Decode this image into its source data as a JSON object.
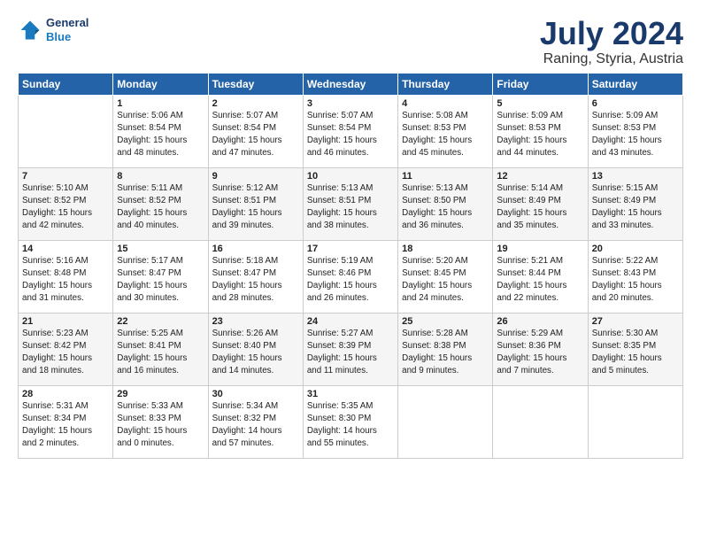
{
  "header": {
    "logo_line1": "General",
    "logo_line2": "Blue",
    "month": "July 2024",
    "location": "Raning, Styria, Austria"
  },
  "weekdays": [
    "Sunday",
    "Monday",
    "Tuesday",
    "Wednesday",
    "Thursday",
    "Friday",
    "Saturday"
  ],
  "weeks": [
    [
      {
        "day": "",
        "info": ""
      },
      {
        "day": "1",
        "info": "Sunrise: 5:06 AM\nSunset: 8:54 PM\nDaylight: 15 hours\nand 48 minutes."
      },
      {
        "day": "2",
        "info": "Sunrise: 5:07 AM\nSunset: 8:54 PM\nDaylight: 15 hours\nand 47 minutes."
      },
      {
        "day": "3",
        "info": "Sunrise: 5:07 AM\nSunset: 8:54 PM\nDaylight: 15 hours\nand 46 minutes."
      },
      {
        "day": "4",
        "info": "Sunrise: 5:08 AM\nSunset: 8:53 PM\nDaylight: 15 hours\nand 45 minutes."
      },
      {
        "day": "5",
        "info": "Sunrise: 5:09 AM\nSunset: 8:53 PM\nDaylight: 15 hours\nand 44 minutes."
      },
      {
        "day": "6",
        "info": "Sunrise: 5:09 AM\nSunset: 8:53 PM\nDaylight: 15 hours\nand 43 minutes."
      }
    ],
    [
      {
        "day": "7",
        "info": "Sunrise: 5:10 AM\nSunset: 8:52 PM\nDaylight: 15 hours\nand 42 minutes."
      },
      {
        "day": "8",
        "info": "Sunrise: 5:11 AM\nSunset: 8:52 PM\nDaylight: 15 hours\nand 40 minutes."
      },
      {
        "day": "9",
        "info": "Sunrise: 5:12 AM\nSunset: 8:51 PM\nDaylight: 15 hours\nand 39 minutes."
      },
      {
        "day": "10",
        "info": "Sunrise: 5:13 AM\nSunset: 8:51 PM\nDaylight: 15 hours\nand 38 minutes."
      },
      {
        "day": "11",
        "info": "Sunrise: 5:13 AM\nSunset: 8:50 PM\nDaylight: 15 hours\nand 36 minutes."
      },
      {
        "day": "12",
        "info": "Sunrise: 5:14 AM\nSunset: 8:49 PM\nDaylight: 15 hours\nand 35 minutes."
      },
      {
        "day": "13",
        "info": "Sunrise: 5:15 AM\nSunset: 8:49 PM\nDaylight: 15 hours\nand 33 minutes."
      }
    ],
    [
      {
        "day": "14",
        "info": "Sunrise: 5:16 AM\nSunset: 8:48 PM\nDaylight: 15 hours\nand 31 minutes."
      },
      {
        "day": "15",
        "info": "Sunrise: 5:17 AM\nSunset: 8:47 PM\nDaylight: 15 hours\nand 30 minutes."
      },
      {
        "day": "16",
        "info": "Sunrise: 5:18 AM\nSunset: 8:47 PM\nDaylight: 15 hours\nand 28 minutes."
      },
      {
        "day": "17",
        "info": "Sunrise: 5:19 AM\nSunset: 8:46 PM\nDaylight: 15 hours\nand 26 minutes."
      },
      {
        "day": "18",
        "info": "Sunrise: 5:20 AM\nSunset: 8:45 PM\nDaylight: 15 hours\nand 24 minutes."
      },
      {
        "day": "19",
        "info": "Sunrise: 5:21 AM\nSunset: 8:44 PM\nDaylight: 15 hours\nand 22 minutes."
      },
      {
        "day": "20",
        "info": "Sunrise: 5:22 AM\nSunset: 8:43 PM\nDaylight: 15 hours\nand 20 minutes."
      }
    ],
    [
      {
        "day": "21",
        "info": "Sunrise: 5:23 AM\nSunset: 8:42 PM\nDaylight: 15 hours\nand 18 minutes."
      },
      {
        "day": "22",
        "info": "Sunrise: 5:25 AM\nSunset: 8:41 PM\nDaylight: 15 hours\nand 16 minutes."
      },
      {
        "day": "23",
        "info": "Sunrise: 5:26 AM\nSunset: 8:40 PM\nDaylight: 15 hours\nand 14 minutes."
      },
      {
        "day": "24",
        "info": "Sunrise: 5:27 AM\nSunset: 8:39 PM\nDaylight: 15 hours\nand 11 minutes."
      },
      {
        "day": "25",
        "info": "Sunrise: 5:28 AM\nSunset: 8:38 PM\nDaylight: 15 hours\nand 9 minutes."
      },
      {
        "day": "26",
        "info": "Sunrise: 5:29 AM\nSunset: 8:36 PM\nDaylight: 15 hours\nand 7 minutes."
      },
      {
        "day": "27",
        "info": "Sunrise: 5:30 AM\nSunset: 8:35 PM\nDaylight: 15 hours\nand 5 minutes."
      }
    ],
    [
      {
        "day": "28",
        "info": "Sunrise: 5:31 AM\nSunset: 8:34 PM\nDaylight: 15 hours\nand 2 minutes."
      },
      {
        "day": "29",
        "info": "Sunrise: 5:33 AM\nSunset: 8:33 PM\nDaylight: 15 hours\nand 0 minutes."
      },
      {
        "day": "30",
        "info": "Sunrise: 5:34 AM\nSunset: 8:32 PM\nDaylight: 14 hours\nand 57 minutes."
      },
      {
        "day": "31",
        "info": "Sunrise: 5:35 AM\nSunset: 8:30 PM\nDaylight: 14 hours\nand 55 minutes."
      },
      {
        "day": "",
        "info": ""
      },
      {
        "day": "",
        "info": ""
      },
      {
        "day": "",
        "info": ""
      }
    ]
  ]
}
